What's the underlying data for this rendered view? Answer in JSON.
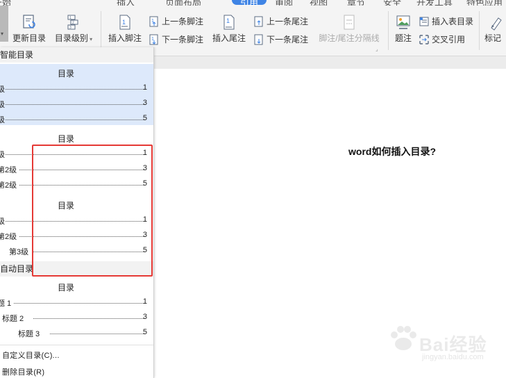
{
  "top_menu": [
    "开始",
    "插入",
    "页面布局",
    "引用",
    "审阅",
    "视图",
    "章节",
    "安全",
    "开发工具",
    "特色应用"
  ],
  "ribbon": {
    "update_toc": "更新目录",
    "toc_level": "目录级别",
    "insert_footnote": "插入脚注",
    "prev_footnote": "上一条脚注",
    "next_footnote": "下一条脚注",
    "insert_endnote": "插入尾注",
    "prev_endnote": "上一条尾注",
    "next_endnote": "下一条尾注",
    "footnote_separator": "脚注/尾注分隔线",
    "caption": "题注",
    "insert_table_of_figures": "插入表目录",
    "cross_reference": "交叉引用",
    "mark": "标记"
  },
  "panel": {
    "smart_toc_header": "智能目录",
    "auto_toc_header": "自动目录",
    "toc_title": "目录",
    "option1": {
      "rows": [
        {
          "label": "级",
          "page": "1"
        },
        {
          "label": "级",
          "page": "3"
        },
        {
          "label": "级",
          "page": "5"
        }
      ]
    },
    "option2": {
      "rows": [
        {
          "label": "级",
          "page": "1"
        },
        {
          "label": "第2级",
          "page": "3"
        },
        {
          "label": "第2级",
          "page": "5"
        }
      ]
    },
    "option3": {
      "rows": [
        {
          "label": "级",
          "page": "1"
        },
        {
          "label": "第2级",
          "page": "3"
        },
        {
          "label": "第3级",
          "page": "5"
        }
      ]
    },
    "auto_option": {
      "rows": [
        {
          "label": "题 1",
          "page": "1"
        },
        {
          "label": "标题 2",
          "page": "3"
        },
        {
          "label": "标题 3",
          "page": "5"
        }
      ]
    },
    "custom_toc": "自定义目录(C)...",
    "delete_toc": "删除目录(R)"
  },
  "document": {
    "heading": "word如何插入目录?"
  },
  "watermark": {
    "brand": "Bai经验",
    "url": "jingyan.baidu.com"
  },
  "colors": {
    "accent": "#3f84e5",
    "selected_bg": "#dde9fb",
    "highlight_box": "#e53935"
  }
}
